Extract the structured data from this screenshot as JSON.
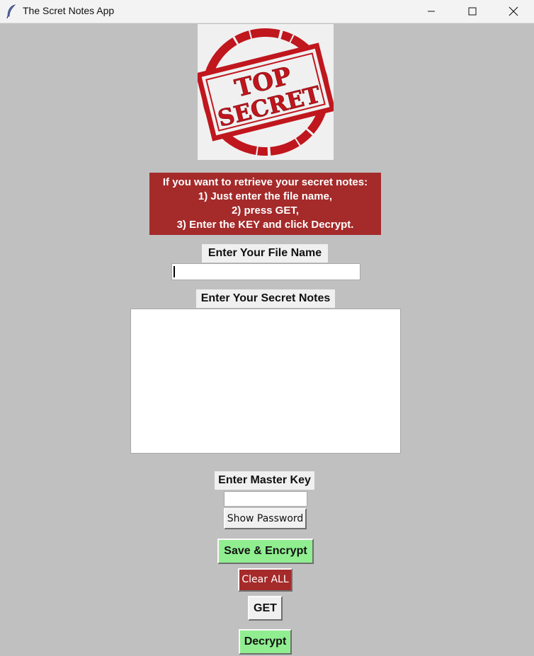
{
  "window": {
    "title": "The Scret Notes App",
    "icon": "feather-icon",
    "controls": [
      "minimize-icon",
      "maximize-icon",
      "close-icon"
    ]
  },
  "logo": {
    "text_line1": "TOP",
    "text_line2": "SECRET",
    "color": "#c0161d"
  },
  "instructions": {
    "line1": "If you want to retrieve your secret notes:",
    "line2": "1) Just enter the file name,",
    "line3": "2) press GET,",
    "line4": "3) Enter the KEY and click Decrypt."
  },
  "file_name": {
    "label": "Enter Your File Name",
    "value": ""
  },
  "secret_notes": {
    "label": "Enter Your Secret Notes",
    "value": ""
  },
  "master_key": {
    "label": "Enter Master Key",
    "value": ""
  },
  "buttons": {
    "show_password": "Show Password",
    "save_encrypt": "Save & Encrypt",
    "clear_all": "Clear ALL",
    "get": "GET",
    "decrypt": "Decrypt"
  },
  "colors": {
    "background": "#c0c0c0",
    "accent_red": "#a52a2a",
    "accent_green": "#90ee90"
  }
}
